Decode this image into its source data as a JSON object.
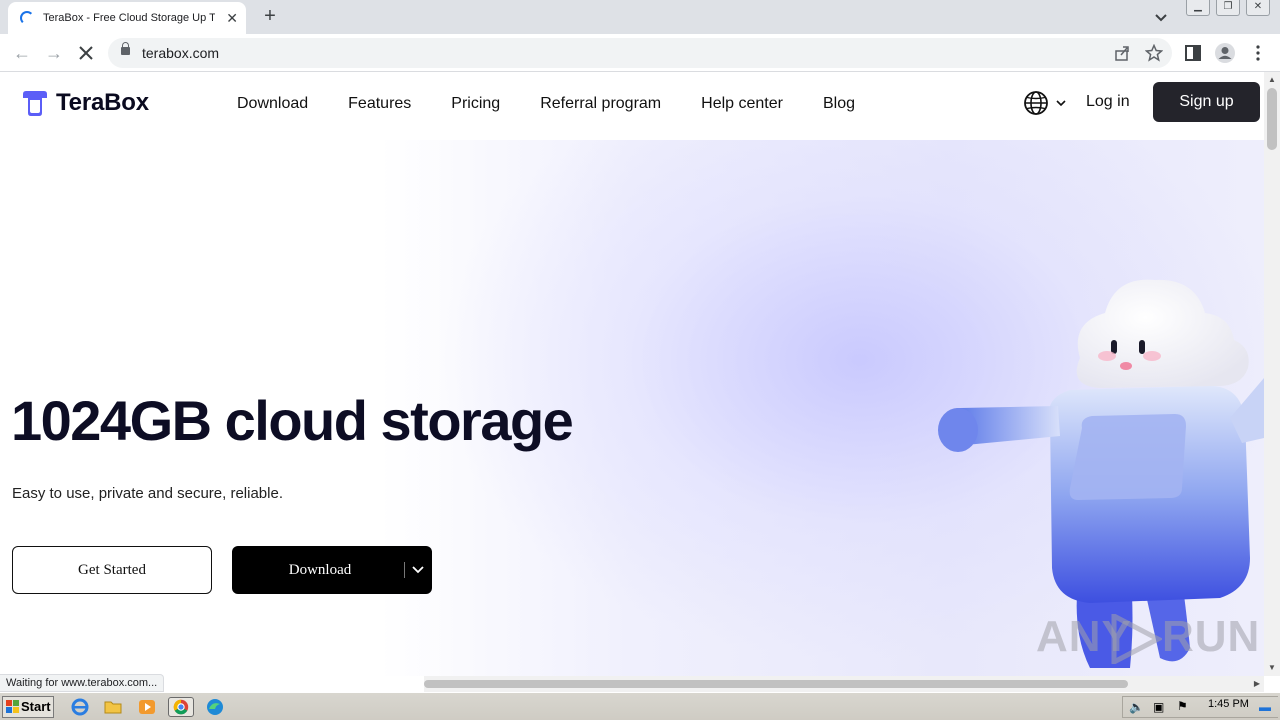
{
  "browser": {
    "tab_title": "TeraBox - Free Cloud Storage Up To",
    "new_tab_label": "+",
    "url": "terabox.com",
    "status_text": "Waiting for www.terabox.com..."
  },
  "site": {
    "brand": "TeraBox",
    "nav_items": [
      "Download",
      "Features",
      "Pricing",
      "Referral program",
      "Help center",
      "Blog"
    ],
    "login_label": "Log in",
    "signup_label": "Sign up",
    "brand_color": "#5b5ef7",
    "signup_bg": "#24242b"
  },
  "hero": {
    "title": "1024GB cloud storage",
    "subtitle": "Easy to use, private and secure, reliable.",
    "get_started_label": "Get Started",
    "download_label": "Download"
  },
  "watermark": {
    "left": "ANY",
    "right": "RUN"
  },
  "taskbar": {
    "start_label": "Start",
    "clock": "1:45 PM"
  }
}
